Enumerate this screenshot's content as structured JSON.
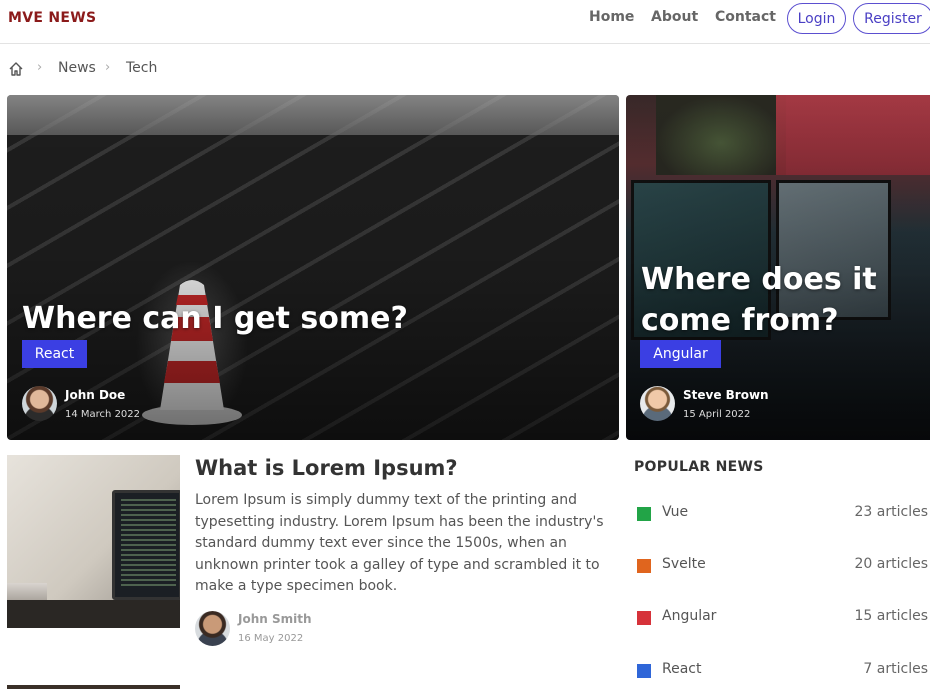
{
  "header": {
    "logo": "MVE NEWS",
    "nav": [
      "Home",
      "About",
      "Contact"
    ],
    "login": "Login",
    "register": "Register"
  },
  "breadcrumb": {
    "items": [
      "News",
      "Tech"
    ]
  },
  "hero": [
    {
      "title": "Where can I get some?",
      "tag": "React",
      "author": "John Doe",
      "date": "14 March 2022"
    },
    {
      "title": "Where does it come from?",
      "tag": "Angular",
      "author": "Steve Brown",
      "date": "15 April 2022"
    }
  ],
  "article": {
    "title": "What is Lorem Ipsum?",
    "text": "Lorem Ipsum is simply dummy text of the printing and typesetting industry. Lorem Ipsum has been the industry's standard dummy text ever since the 1500s, when an unknown printer took a galley of type and scrambled it to make a type specimen book.",
    "author": "John Smith",
    "date": "16 May 2022"
  },
  "popular": {
    "title": "POPULAR NEWS",
    "items": [
      {
        "label": "Vue",
        "count": "23 articles",
        "color": "#22a447"
      },
      {
        "label": "Svelte",
        "count": "20 articles",
        "color": "#e0651e"
      },
      {
        "label": "Angular",
        "count": "15 articles",
        "color": "#d6323a"
      },
      {
        "label": "React",
        "count": "7 articles",
        "color": "#2f66d8"
      }
    ]
  },
  "colors": {
    "brand": "#8b1a1a",
    "accent": "#3b3fe3",
    "outline": "#5b4fd0"
  }
}
